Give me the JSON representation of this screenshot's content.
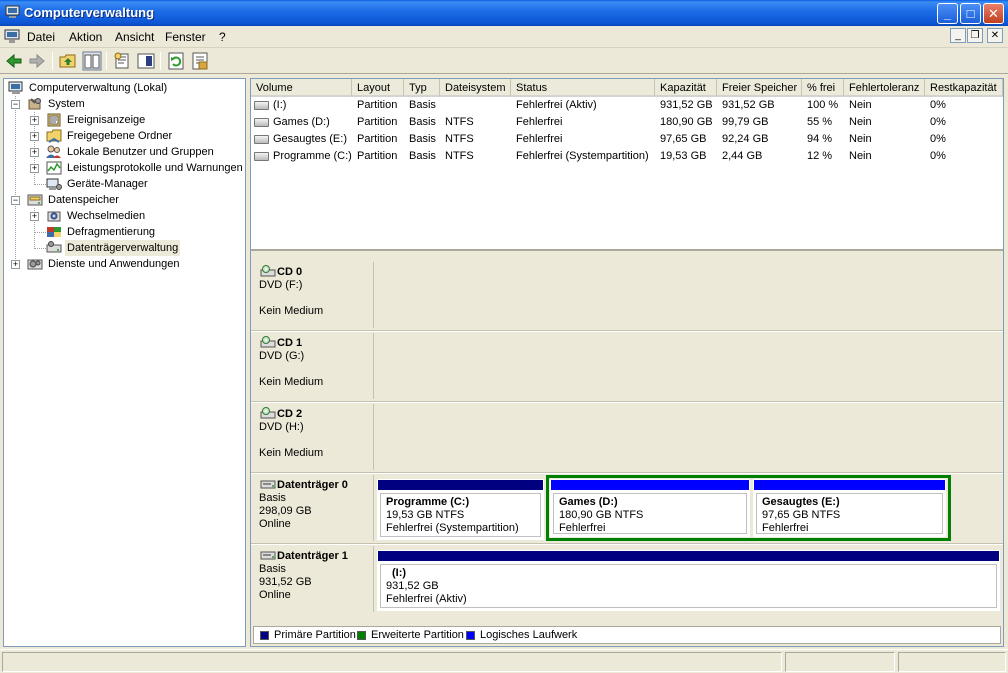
{
  "window": {
    "title": "Computerverwaltung"
  },
  "menu": {
    "items": [
      "Datei",
      "Aktion",
      "Ansicht",
      "Fenster",
      "?"
    ]
  },
  "tree": {
    "root": "Computerverwaltung (Lokal)",
    "system": "System",
    "ereignis": "Ereignisanzeige",
    "freigegeben": "Freigegebene Ordner",
    "benutzer": "Lokale Benutzer und Gruppen",
    "leistung": "Leistungsprotokolle und Warnungen",
    "geraete": "Geräte-Manager",
    "datenspeicher": "Datenspeicher",
    "wechsel": "Wechselmedien",
    "defrag": "Defragmentierung",
    "dtv": "Datenträgerverwaltung",
    "dienste": "Dienste und Anwendungen"
  },
  "volumes": {
    "columns": [
      "Volume",
      "Layout",
      "Typ",
      "Dateisystem",
      "Status",
      "Kapazität",
      "Freier Speicher",
      "% frei",
      "Fehlertoleranz",
      "Restkapazität"
    ],
    "rows": [
      [
        "(I:)",
        "Partition",
        "Basis",
        "",
        "Fehlerfrei (Aktiv)",
        "931,52 GB",
        "931,52 GB",
        "100 %",
        "Nein",
        "0%"
      ],
      [
        "Games (D:)",
        "Partition",
        "Basis",
        "NTFS",
        "Fehlerfrei",
        "180,90 GB",
        "99,79 GB",
        "55 %",
        "Nein",
        "0%"
      ],
      [
        "Gesaugtes (E:)",
        "Partition",
        "Basis",
        "NTFS",
        "Fehlerfrei",
        "97,65 GB",
        "92,24 GB",
        "94 %",
        "Nein",
        "0%"
      ],
      [
        "Programme (C:)",
        "Partition",
        "Basis",
        "NTFS",
        "Fehlerfrei (Systempartition)",
        "19,53 GB",
        "2,44 GB",
        "12 %",
        "Nein",
        "0%"
      ]
    ]
  },
  "disks": {
    "cd0": {
      "name": "CD 0",
      "drive": "DVD (F:)",
      "media": "Kein Medium"
    },
    "cd1": {
      "name": "CD 1",
      "drive": "DVD (G:)",
      "media": "Kein Medium"
    },
    "cd2": {
      "name": "CD 2",
      "drive": "DVD (H:)",
      "media": "Kein Medium"
    },
    "disk0": {
      "name": "Datenträger 0",
      "type": "Basis",
      "size": "298,09 GB",
      "state": "Online",
      "p_c": {
        "name": "Programme  (C:)",
        "size": "19,53 GB NTFS",
        "status": "Fehlerfrei (Systempartition)"
      },
      "p_d": {
        "name": "Games  (D:)",
        "size": "180,90 GB NTFS",
        "status": "Fehlerfrei"
      },
      "p_e": {
        "name": "Gesaugtes  (E:)",
        "size": "97,65 GB NTFS",
        "status": "Fehlerfrei"
      }
    },
    "disk1": {
      "name": "Datenträger 1",
      "type": "Basis",
      "size": "931,52 GB",
      "state": "Online",
      "p_i": {
        "name": "(I:)",
        "size": "931,52 GB",
        "status": "Fehlerfrei (Aktiv)"
      }
    }
  },
  "legend": {
    "primary": "Primäre Partition",
    "extended": "Erweiterte Partition",
    "logical": "Logisches Laufwerk"
  },
  "colors": {
    "primary": "#000080",
    "extended": "#008000",
    "logical": "#0000ff"
  }
}
